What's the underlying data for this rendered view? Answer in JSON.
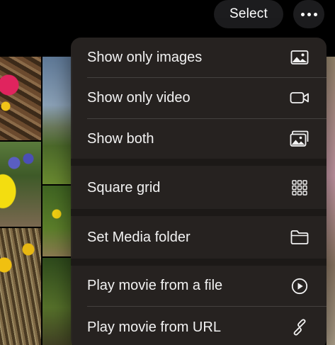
{
  "toolbar": {
    "select_label": "Select",
    "more_icon": "ellipsis-icon"
  },
  "menu": {
    "sections": [
      {
        "items": [
          {
            "label": "Show only images",
            "icon": "photo-icon"
          },
          {
            "label": "Show only video",
            "icon": "video-camera-icon"
          },
          {
            "label": "Show both",
            "icon": "photo-stack-icon"
          }
        ]
      },
      {
        "items": [
          {
            "label": "Square grid",
            "icon": "grid-icon"
          }
        ]
      },
      {
        "items": [
          {
            "label": "Set Media folder",
            "icon": "folder-icon"
          }
        ]
      },
      {
        "items": [
          {
            "label": "Play movie from a file",
            "icon": "play-circle-icon"
          },
          {
            "label": "Play movie from URL",
            "icon": "link-icon"
          }
        ]
      }
    ]
  },
  "colors": {
    "menu_background": "#282422",
    "text": "#f2f2f2",
    "button_background": "#1c1c1e"
  }
}
